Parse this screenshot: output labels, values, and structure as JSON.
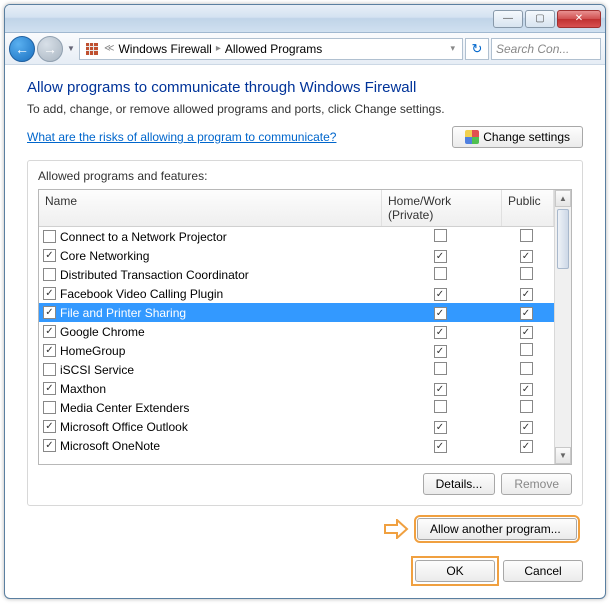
{
  "titlebar": {},
  "nav": {
    "crumb1": "Windows Firewall",
    "crumb2": "Allowed Programs",
    "search_placeholder": "Search Con..."
  },
  "page": {
    "title": "Allow programs to communicate through Windows Firewall",
    "subtitle": "To add, change, or remove allowed programs and ports, click Change settings.",
    "risk_link": "What are the risks of allowing a program to communicate?",
    "change_settings": "Change settings",
    "group_label": "Allowed programs and features:",
    "col_name": "Name",
    "col_hw": "Home/Work (Private)",
    "col_pub": "Public",
    "details": "Details...",
    "remove": "Remove",
    "allow_another": "Allow another program...",
    "ok": "OK",
    "cancel": "Cancel"
  },
  "rows": [
    {
      "name": "Connect to a Network Projector",
      "on": false,
      "hw": false,
      "pub": false,
      "sel": false
    },
    {
      "name": "Core Networking",
      "on": true,
      "hw": true,
      "pub": true,
      "sel": false
    },
    {
      "name": "Distributed Transaction Coordinator",
      "on": false,
      "hw": false,
      "pub": false,
      "sel": false
    },
    {
      "name": "Facebook Video Calling Plugin",
      "on": true,
      "hw": true,
      "pub": true,
      "sel": false
    },
    {
      "name": "File and Printer Sharing",
      "on": true,
      "hw": true,
      "pub": true,
      "sel": true
    },
    {
      "name": "Google Chrome",
      "on": true,
      "hw": true,
      "pub": true,
      "sel": false
    },
    {
      "name": "HomeGroup",
      "on": true,
      "hw": true,
      "pub": false,
      "sel": false
    },
    {
      "name": "iSCSI Service",
      "on": false,
      "hw": false,
      "pub": false,
      "sel": false
    },
    {
      "name": "Maxthon",
      "on": true,
      "hw": true,
      "pub": true,
      "sel": false
    },
    {
      "name": "Media Center Extenders",
      "on": false,
      "hw": false,
      "pub": false,
      "sel": false
    },
    {
      "name": "Microsoft Office Outlook",
      "on": true,
      "hw": true,
      "pub": true,
      "sel": false
    },
    {
      "name": "Microsoft OneNote",
      "on": true,
      "hw": true,
      "pub": true,
      "sel": false
    }
  ]
}
